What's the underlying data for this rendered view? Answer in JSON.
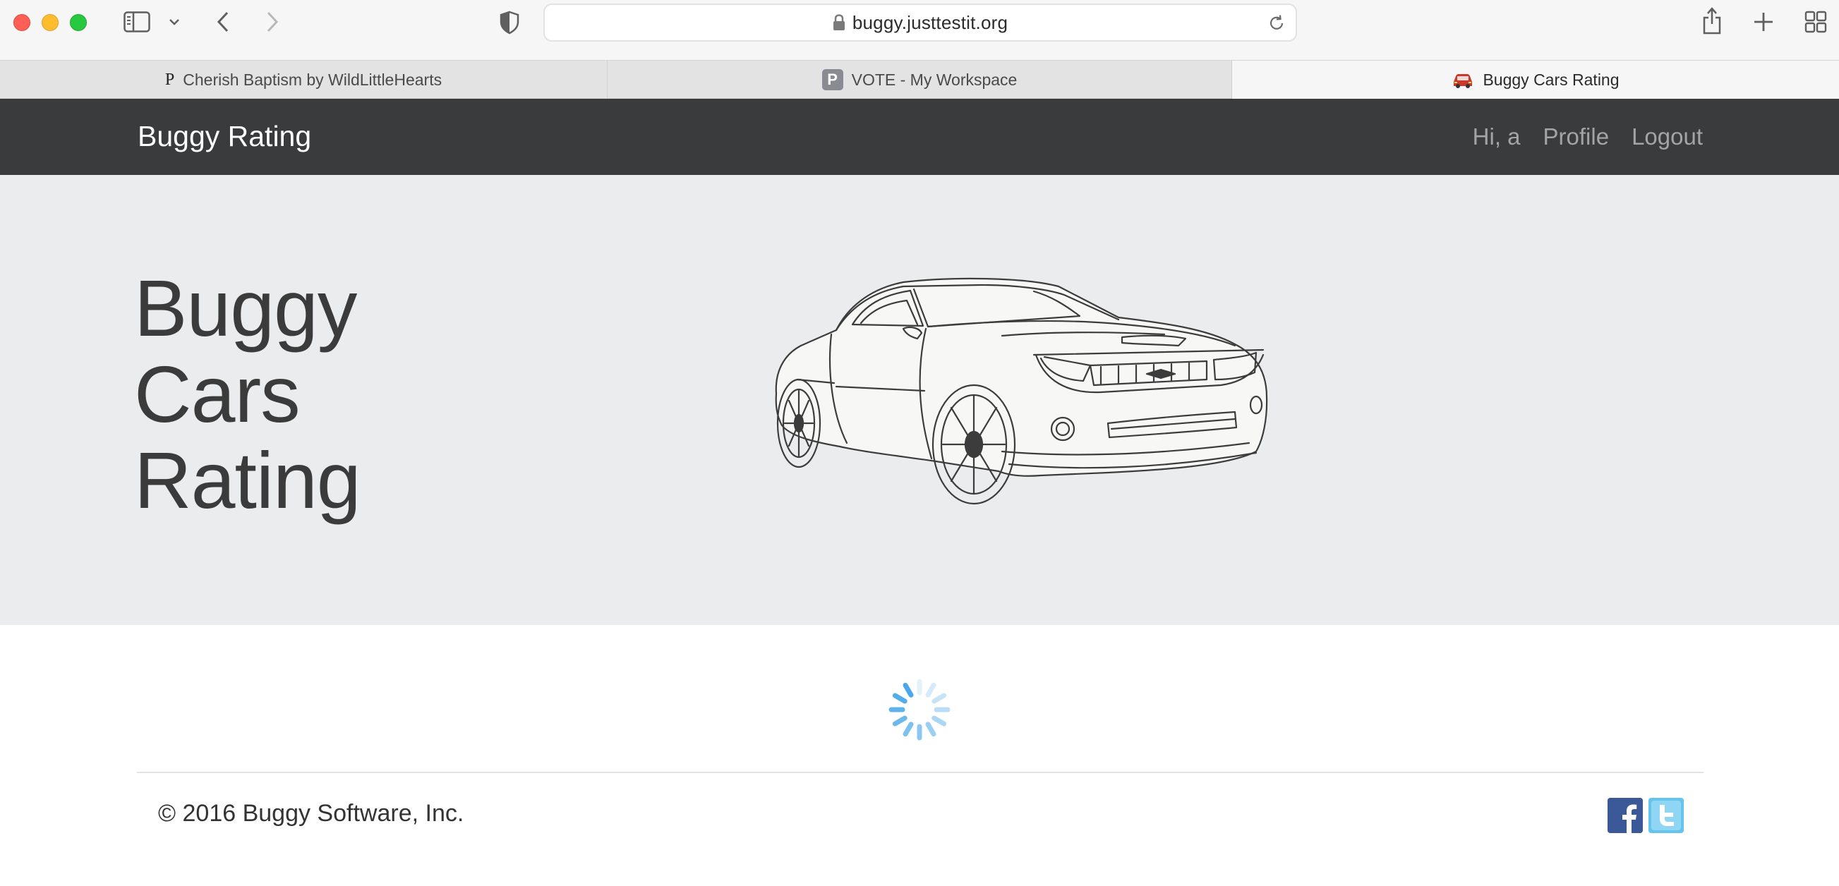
{
  "browser": {
    "url": "buggy.justtestit.org",
    "tabs": [
      {
        "label": "Cherish Baptism by WildLittleHearts",
        "favicon": "p-serif-icon"
      },
      {
        "label": "VOTE - My Workspace",
        "favicon": "p-box-icon",
        "favicon_letter": "P"
      },
      {
        "label": "Buggy Cars Rating",
        "favicon": "car-icon",
        "active": true
      }
    ],
    "first_tab_favicon_letter": "P"
  },
  "navbar": {
    "brand": "Buggy Rating",
    "greeting": "Hi, a",
    "profile": "Profile",
    "logout": "Logout"
  },
  "hero": {
    "title_lines": [
      "Buggy",
      "Cars",
      "Rating"
    ]
  },
  "footer": {
    "copyright": "© 2016 Buggy Software, Inc.",
    "social": [
      "facebook-icon",
      "twitter-icon"
    ]
  },
  "colors": {
    "navbar_bg": "#3a3b3d",
    "hero_bg": "#ebecee",
    "spinner": "#4aa8e8",
    "facebook": "#3b5998",
    "twitter": "#65c4ee"
  }
}
